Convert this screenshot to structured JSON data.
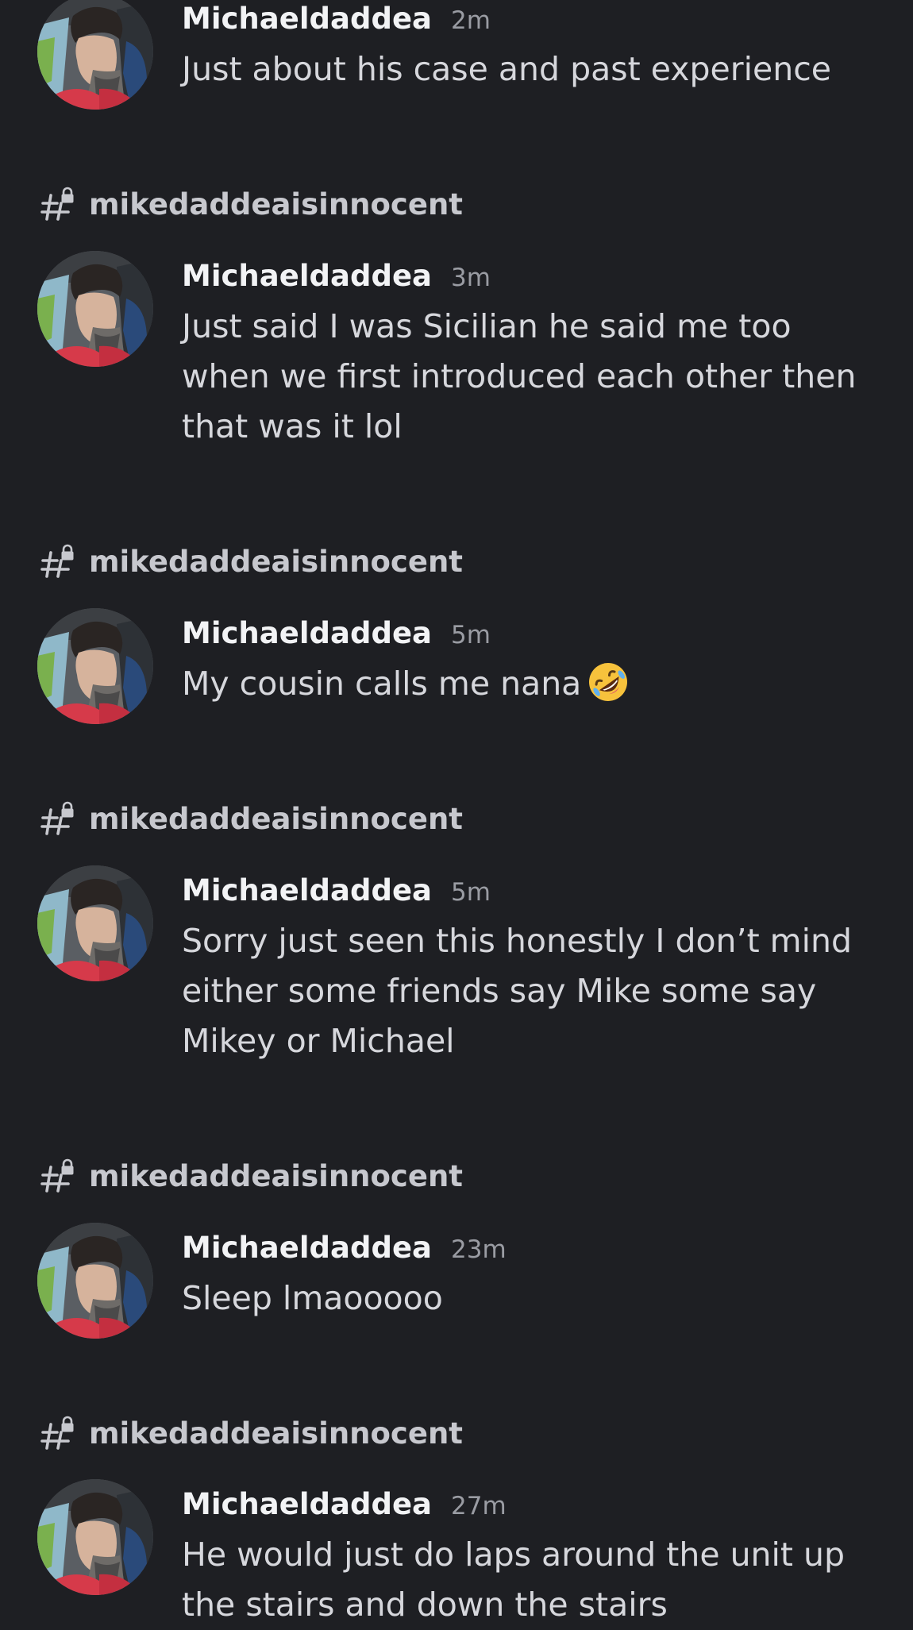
{
  "channel_name": "mikedaddeaisinnocent",
  "messages": [
    {
      "author": "Michaeldaddea",
      "time": "2m",
      "lines": [
        "Just about his case and past experience"
      ]
    },
    {
      "author": "Michaeldaddea",
      "time": "3m",
      "lines": [
        "Just said I was Sicilian he said me too",
        "when we first introduced each other then",
        "that was it lol"
      ]
    },
    {
      "author": "Michaeldaddea",
      "time": "5m",
      "lines": [
        "My cousin calls me nana"
      ],
      "emoji": "rolling-on-floor-laughing-emoji"
    },
    {
      "author": "Michaeldaddea",
      "time": "5m",
      "lines": [
        "Sorry just seen this honestly I don’t mind",
        "either some friends say Mike some say",
        "Mikey or Michael"
      ]
    },
    {
      "author": "Michaeldaddea",
      "time": "23m",
      "lines": [
        "Sleep lmaooooo"
      ]
    },
    {
      "author": "Michaeldaddea",
      "time": "27m",
      "lines": [
        "He would just do laps around the unit up",
        "the stairs and down the stairs"
      ]
    }
  ],
  "icons": {
    "channel": "hashtag-lock-icon",
    "avatar": "user-avatar"
  },
  "colors": {
    "background": "#1e1f23",
    "author": "#f2f3f5",
    "timestamp": "#9a9ca3",
    "message_text": "#d6d7dc",
    "channel_text": "#c7c8ce"
  }
}
